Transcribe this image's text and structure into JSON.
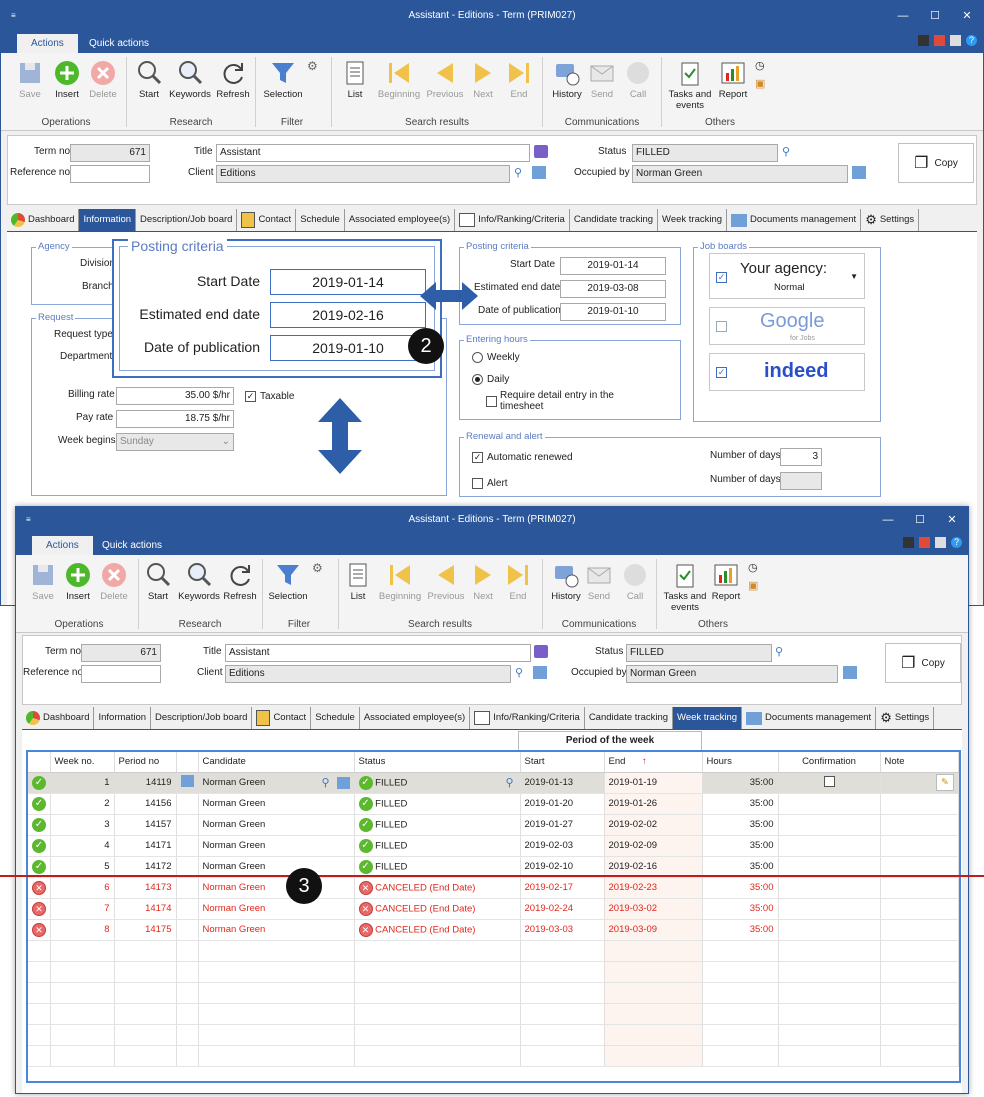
{
  "window1": {
    "title": "Assistant - Editions - Term (PRIM027)",
    "ribbon_tabs": [
      "Actions",
      "Quick actions"
    ],
    "buttons": {
      "save": "Save",
      "insert": "Insert",
      "delete": "Delete",
      "start": "Start",
      "keywords": "Keywords",
      "refresh": "Refresh",
      "selection": "Selection",
      "list": "List",
      "beginning": "Beginning",
      "previous": "Previous",
      "next": "Next",
      "end": "End",
      "history": "History",
      "send": "Send",
      "call": "Call",
      "tasks": "Tasks and events",
      "report": "Report"
    },
    "groups": {
      "operations": "Operations",
      "research": "Research",
      "filter": "Filter",
      "search_results": "Search results",
      "communications": "Communications",
      "others": "Others"
    },
    "header": {
      "term_no_label": "Term no",
      "term_no": "671",
      "reference_no_label": "Reference no",
      "title_label": "Title",
      "title": "Assistant",
      "client_label": "Client",
      "client": "Editions",
      "status_label": "Status",
      "status": "FILLED",
      "occupied_label": "Occupied by",
      "occupied": "Norman Green",
      "copy": "Copy"
    },
    "tabs": [
      "Dashboard",
      "Information",
      "Description/Job board",
      "Contact",
      "Schedule",
      "Associated employee(s)",
      "Info/Ranking/Criteria",
      "Candidate tracking",
      "Week tracking",
      "Documents management",
      "Settings"
    ],
    "agency": {
      "title": "Agency",
      "division": "Division",
      "branch": "Branch"
    },
    "request": {
      "title": "Request",
      "request_type": "Request type",
      "department": "Department",
      "billing_rate_label": "Billing rate",
      "billing_rate": "35.00 $/hr",
      "taxable": "Taxable",
      "pay_rate_label": "Pay rate",
      "pay_rate": "18.75 $/hr",
      "week_begins_label": "Week begins",
      "week_begins": "Sunday"
    },
    "posting_zoom": {
      "title": "Posting criteria",
      "start_label": "Start Date",
      "start": "2019-01-14",
      "end_label": "Estimated end date",
      "end": "2019-02-16",
      "pub_label": "Date of publication",
      "pub": "2019-01-10"
    },
    "posting": {
      "title": "Posting criteria",
      "start_label": "Start Date",
      "start": "2019-01-14",
      "end_label": "Estimated end date",
      "end": "2019-03-08",
      "pub_label": "Date of publication",
      "pub": "2019-01-10"
    },
    "hours": {
      "title": "Entering hours",
      "weekly": "Weekly",
      "daily": "Daily",
      "require": "Require detail entry in the timesheet"
    },
    "renewal": {
      "title": "Renewal and alert",
      "auto": "Automatic renewed",
      "days_label": "Number of days",
      "days": "3",
      "alert": "Alert",
      "days_label2": "Number of days"
    },
    "jobboards": {
      "title": "Job boards",
      "agency_line1": "Your agency:",
      "agency_line2": "Normal",
      "google": "Google",
      "google_sub": "for Jobs",
      "indeed": "indeed"
    }
  },
  "window2": {
    "title": "Assistant - Editions - Term (PRIM027)",
    "active_tab": "Week tracking",
    "period_header": "Period of the week",
    "columns": [
      "Week no.",
      "Period no",
      "Candidate",
      "Status",
      "Start",
      "End",
      "Hours",
      "Confirmation",
      "Note"
    ],
    "rows": [
      {
        "week": "1",
        "period": "14119",
        "candidate": "Norman Green",
        "status": "FILLED",
        "start": "2019-01-13",
        "end": "2019-01-19",
        "hours": "35:00",
        "ok": true
      },
      {
        "week": "2",
        "period": "14156",
        "candidate": "Norman Green",
        "status": "FILLED",
        "start": "2019-01-20",
        "end": "2019-01-26",
        "hours": "35:00",
        "ok": true
      },
      {
        "week": "3",
        "period": "14157",
        "candidate": "Norman Green",
        "status": "FILLED",
        "start": "2019-01-27",
        "end": "2019-02-02",
        "hours": "35:00",
        "ok": true
      },
      {
        "week": "4",
        "period": "14171",
        "candidate": "Norman Green",
        "status": "FILLED",
        "start": "2019-02-03",
        "end": "2019-02-09",
        "hours": "35:00",
        "ok": true
      },
      {
        "week": "5",
        "period": "14172",
        "candidate": "Norman Green",
        "status": "FILLED",
        "start": "2019-02-10",
        "end": "2019-02-16",
        "hours": "35:00",
        "ok": true
      },
      {
        "week": "6",
        "period": "14173",
        "candidate": "Norman Green",
        "status": "CANCELED (End Date)",
        "start": "2019-02-17",
        "end": "2019-02-23",
        "hours": "35:00",
        "ok": false
      },
      {
        "week": "7",
        "period": "14174",
        "candidate": "Norman Green",
        "status": "CANCELED (End Date)",
        "start": "2019-02-24",
        "end": "2019-03-02",
        "hours": "35:00",
        "ok": false
      },
      {
        "week": "8",
        "period": "14175",
        "candidate": "Norman Green",
        "status": "CANCELED (End Date)",
        "start": "2019-03-03",
        "end": "2019-03-09",
        "hours": "35:00",
        "ok": false
      }
    ]
  },
  "callouts": {
    "two": "2",
    "three": "3"
  }
}
